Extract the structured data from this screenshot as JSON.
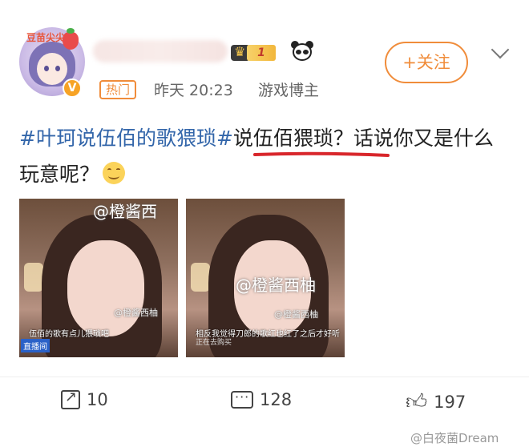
{
  "header": {
    "avatar_tag": "豆苗尖尖",
    "username": "",
    "vip_level": "1",
    "hot_label": "热门",
    "time": "昨天 20:23",
    "role": "游戏博主",
    "follow_label": "+关注"
  },
  "post": {
    "hashtag": "#叶珂说伍佰的歌猥琐#",
    "highlight": "说伍佰猥琐",
    "rest": "？话说你又是什么玩意呢？"
  },
  "images": [
    {
      "watermark": "@橙酱西",
      "sub_watermark": "@橙酱西柚",
      "caption": "伍佰的歌有点儿猥琐吧",
      "badge": "直播间"
    },
    {
      "watermark": "@橙酱西柚",
      "sub_watermark": "@橙酱西柚",
      "caption": "相反我觉得刀郎的歌红也红了之后才好听",
      "sub": "正在去购买"
    }
  ],
  "actions": {
    "shares": "10",
    "comments": "128",
    "likes": "197"
  },
  "source_watermark": "@白夜菌Dream",
  "colors": {
    "accent": "#f08c3a",
    "hashtag": "#3366aa",
    "underline": "#d8262b"
  },
  "icons": [
    "verified-icon",
    "crown-icon",
    "panda-icon",
    "chevron-down-icon",
    "share-icon",
    "comment-icon",
    "like-icon",
    "smile-emoji-icon"
  ]
}
